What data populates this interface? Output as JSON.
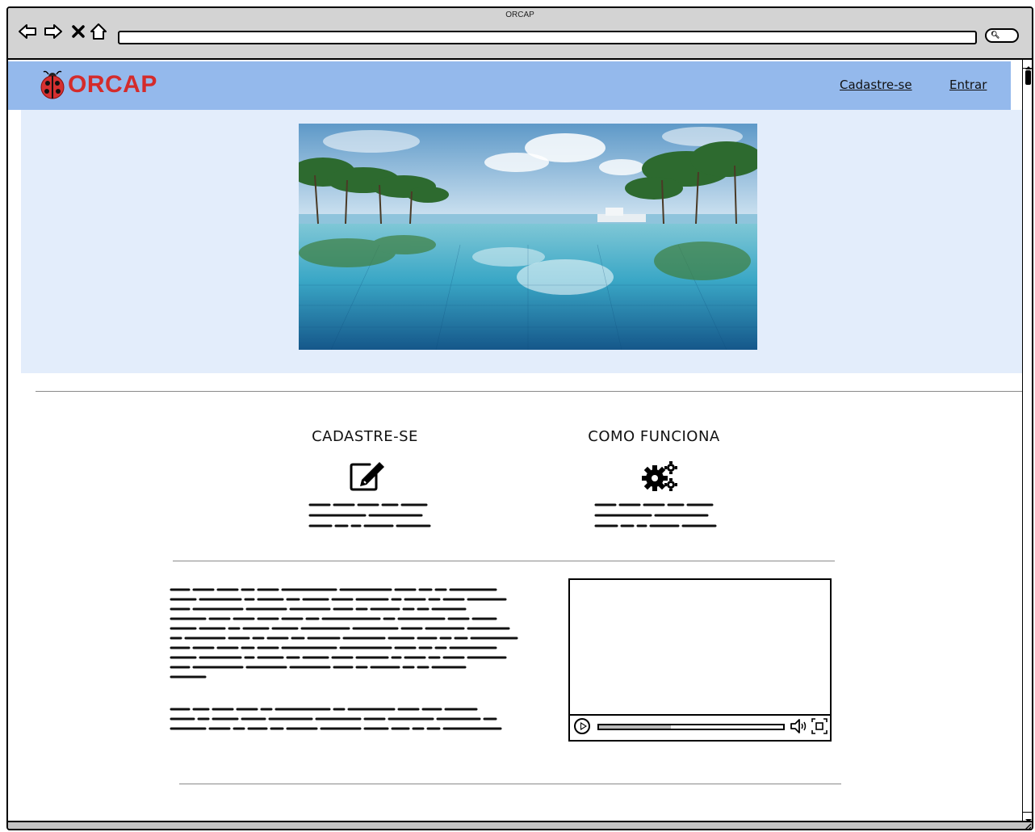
{
  "window": {
    "title": "ORCAP"
  },
  "browser": {
    "back_icon": "back-arrow-icon",
    "forward_icon": "forward-arrow-icon",
    "stop_icon": "close-x-icon",
    "home_icon": "home-icon",
    "search_icon": "search-icon"
  },
  "header": {
    "brand": "ORCAP",
    "logo_icon": "ladybug-logo-icon",
    "nav": [
      {
        "label": "Cadastre-se"
      },
      {
        "label": "Entrar"
      }
    ],
    "background": "#94b9ec",
    "brand_color": "#d42b2b"
  },
  "hero": {
    "background": "#e3edfb",
    "image_icon": "pool-beach-image"
  },
  "features": [
    {
      "title": "CADASTRE-SE",
      "icon": "edit-pencil-icon"
    },
    {
      "title": "COMO FUNCIONA",
      "icon": "gears-icon"
    }
  ],
  "video": {
    "progress": 0.39,
    "play_icon": "play-icon",
    "volume_icon": "volume-icon",
    "fullscreen_icon": "fullscreen-icon"
  }
}
